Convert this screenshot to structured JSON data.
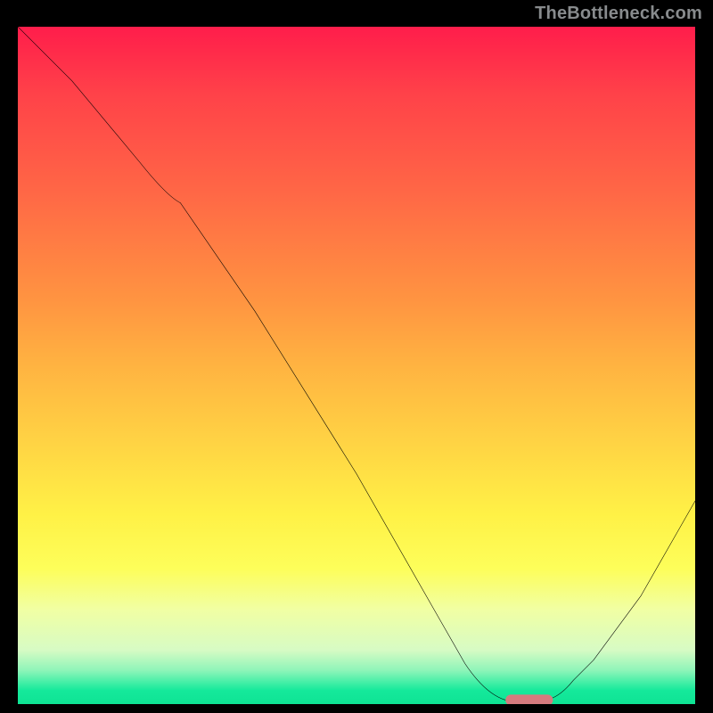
{
  "branding": {
    "watermark": "TheBottleneck.com"
  },
  "chart_data": {
    "type": "line",
    "title": "",
    "xlabel": "",
    "ylabel": "",
    "xlim": [
      0,
      100
    ],
    "ylim": [
      0,
      100
    ],
    "grid": false,
    "legend": false,
    "series": [
      {
        "name": "curve",
        "color": "#000000",
        "x": [
          0,
          8,
          18,
          24,
          35,
          50,
          62,
          66,
          70,
          74,
          78,
          85,
          92,
          100
        ],
        "y": [
          100,
          92,
          80,
          74,
          58,
          34,
          13,
          6,
          2,
          1,
          1,
          6,
          16,
          30
        ]
      }
    ],
    "marker": {
      "name": "optimal-marker",
      "x_pct": 75,
      "y_pct": 0.3,
      "color": "#d57a7e"
    },
    "background_gradient": {
      "stops": [
        {
          "pct": 0,
          "color": "#ff1d4b"
        },
        {
          "pct": 10,
          "color": "#ff4249"
        },
        {
          "pct": 24,
          "color": "#ff6646"
        },
        {
          "pct": 40,
          "color": "#ff9341"
        },
        {
          "pct": 50,
          "color": "#ffb341"
        },
        {
          "pct": 62,
          "color": "#ffd544"
        },
        {
          "pct": 72,
          "color": "#fff146"
        },
        {
          "pct": 80,
          "color": "#fdfe5a"
        },
        {
          "pct": 86,
          "color": "#f1ffa3"
        },
        {
          "pct": 92,
          "color": "#d7fbc4"
        },
        {
          "pct": 95,
          "color": "#8ff5b9"
        },
        {
          "pct": 97,
          "color": "#3ceea5"
        },
        {
          "pct": 98,
          "color": "#15e99b"
        },
        {
          "pct": 100,
          "color": "#0ee394"
        }
      ]
    }
  }
}
